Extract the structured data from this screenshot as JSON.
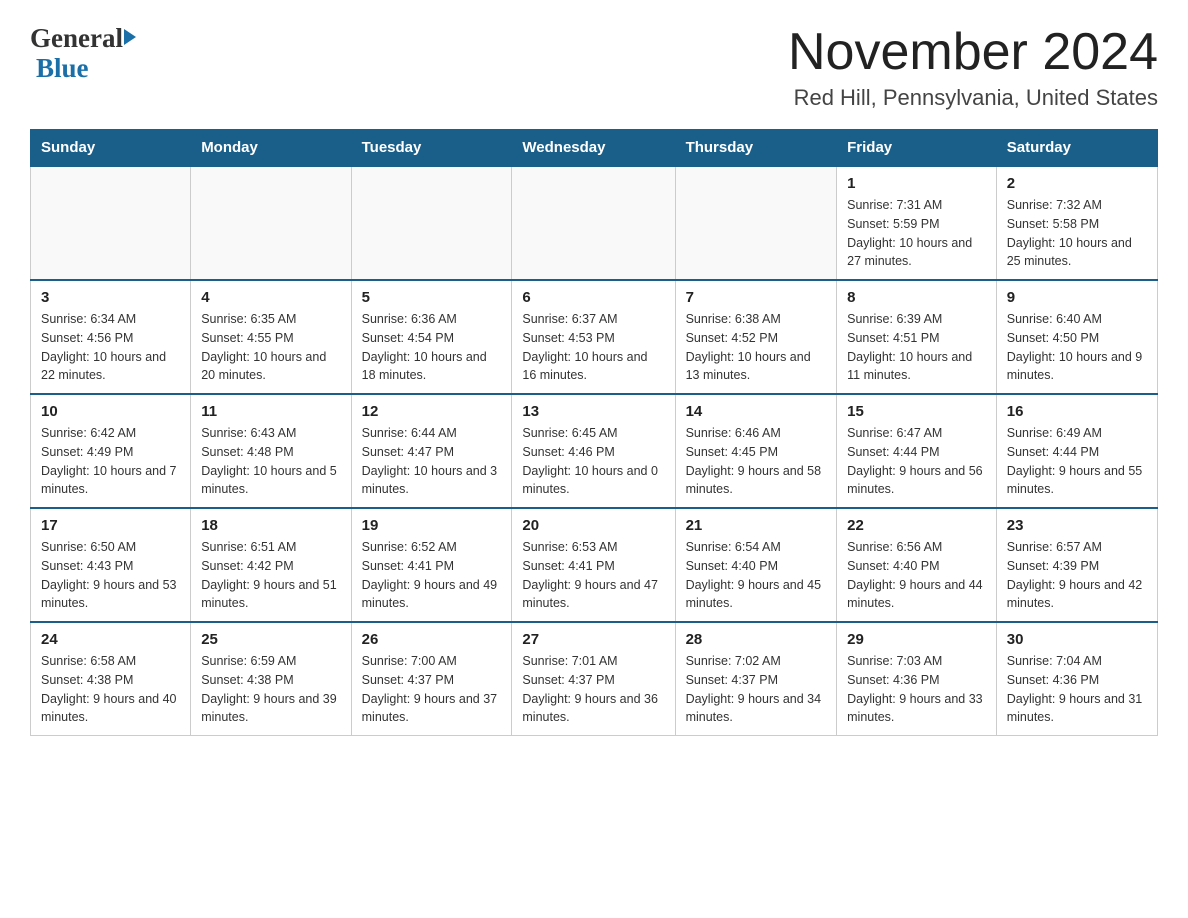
{
  "header": {
    "logo_general": "General",
    "logo_blue": "Blue",
    "main_title": "November 2024",
    "subtitle": "Red Hill, Pennsylvania, United States"
  },
  "calendar": {
    "days_of_week": [
      "Sunday",
      "Monday",
      "Tuesday",
      "Wednesday",
      "Thursday",
      "Friday",
      "Saturday"
    ],
    "weeks": [
      {
        "days": [
          {
            "num": "",
            "info": ""
          },
          {
            "num": "",
            "info": ""
          },
          {
            "num": "",
            "info": ""
          },
          {
            "num": "",
            "info": ""
          },
          {
            "num": "",
            "info": ""
          },
          {
            "num": "1",
            "info": "Sunrise: 7:31 AM\nSunset: 5:59 PM\nDaylight: 10 hours and 27 minutes."
          },
          {
            "num": "2",
            "info": "Sunrise: 7:32 AM\nSunset: 5:58 PM\nDaylight: 10 hours and 25 minutes."
          }
        ]
      },
      {
        "days": [
          {
            "num": "3",
            "info": "Sunrise: 6:34 AM\nSunset: 4:56 PM\nDaylight: 10 hours and 22 minutes."
          },
          {
            "num": "4",
            "info": "Sunrise: 6:35 AM\nSunset: 4:55 PM\nDaylight: 10 hours and 20 minutes."
          },
          {
            "num": "5",
            "info": "Sunrise: 6:36 AM\nSunset: 4:54 PM\nDaylight: 10 hours and 18 minutes."
          },
          {
            "num": "6",
            "info": "Sunrise: 6:37 AM\nSunset: 4:53 PM\nDaylight: 10 hours and 16 minutes."
          },
          {
            "num": "7",
            "info": "Sunrise: 6:38 AM\nSunset: 4:52 PM\nDaylight: 10 hours and 13 minutes."
          },
          {
            "num": "8",
            "info": "Sunrise: 6:39 AM\nSunset: 4:51 PM\nDaylight: 10 hours and 11 minutes."
          },
          {
            "num": "9",
            "info": "Sunrise: 6:40 AM\nSunset: 4:50 PM\nDaylight: 10 hours and 9 minutes."
          }
        ]
      },
      {
        "days": [
          {
            "num": "10",
            "info": "Sunrise: 6:42 AM\nSunset: 4:49 PM\nDaylight: 10 hours and 7 minutes."
          },
          {
            "num": "11",
            "info": "Sunrise: 6:43 AM\nSunset: 4:48 PM\nDaylight: 10 hours and 5 minutes."
          },
          {
            "num": "12",
            "info": "Sunrise: 6:44 AM\nSunset: 4:47 PM\nDaylight: 10 hours and 3 minutes."
          },
          {
            "num": "13",
            "info": "Sunrise: 6:45 AM\nSunset: 4:46 PM\nDaylight: 10 hours and 0 minutes."
          },
          {
            "num": "14",
            "info": "Sunrise: 6:46 AM\nSunset: 4:45 PM\nDaylight: 9 hours and 58 minutes."
          },
          {
            "num": "15",
            "info": "Sunrise: 6:47 AM\nSunset: 4:44 PM\nDaylight: 9 hours and 56 minutes."
          },
          {
            "num": "16",
            "info": "Sunrise: 6:49 AM\nSunset: 4:44 PM\nDaylight: 9 hours and 55 minutes."
          }
        ]
      },
      {
        "days": [
          {
            "num": "17",
            "info": "Sunrise: 6:50 AM\nSunset: 4:43 PM\nDaylight: 9 hours and 53 minutes."
          },
          {
            "num": "18",
            "info": "Sunrise: 6:51 AM\nSunset: 4:42 PM\nDaylight: 9 hours and 51 minutes."
          },
          {
            "num": "19",
            "info": "Sunrise: 6:52 AM\nSunset: 4:41 PM\nDaylight: 9 hours and 49 minutes."
          },
          {
            "num": "20",
            "info": "Sunrise: 6:53 AM\nSunset: 4:41 PM\nDaylight: 9 hours and 47 minutes."
          },
          {
            "num": "21",
            "info": "Sunrise: 6:54 AM\nSunset: 4:40 PM\nDaylight: 9 hours and 45 minutes."
          },
          {
            "num": "22",
            "info": "Sunrise: 6:56 AM\nSunset: 4:40 PM\nDaylight: 9 hours and 44 minutes."
          },
          {
            "num": "23",
            "info": "Sunrise: 6:57 AM\nSunset: 4:39 PM\nDaylight: 9 hours and 42 minutes."
          }
        ]
      },
      {
        "days": [
          {
            "num": "24",
            "info": "Sunrise: 6:58 AM\nSunset: 4:38 PM\nDaylight: 9 hours and 40 minutes."
          },
          {
            "num": "25",
            "info": "Sunrise: 6:59 AM\nSunset: 4:38 PM\nDaylight: 9 hours and 39 minutes."
          },
          {
            "num": "26",
            "info": "Sunrise: 7:00 AM\nSunset: 4:37 PM\nDaylight: 9 hours and 37 minutes."
          },
          {
            "num": "27",
            "info": "Sunrise: 7:01 AM\nSunset: 4:37 PM\nDaylight: 9 hours and 36 minutes."
          },
          {
            "num": "28",
            "info": "Sunrise: 7:02 AM\nSunset: 4:37 PM\nDaylight: 9 hours and 34 minutes."
          },
          {
            "num": "29",
            "info": "Sunrise: 7:03 AM\nSunset: 4:36 PM\nDaylight: 9 hours and 33 minutes."
          },
          {
            "num": "30",
            "info": "Sunrise: 7:04 AM\nSunset: 4:36 PM\nDaylight: 9 hours and 31 minutes."
          }
        ]
      }
    ]
  }
}
